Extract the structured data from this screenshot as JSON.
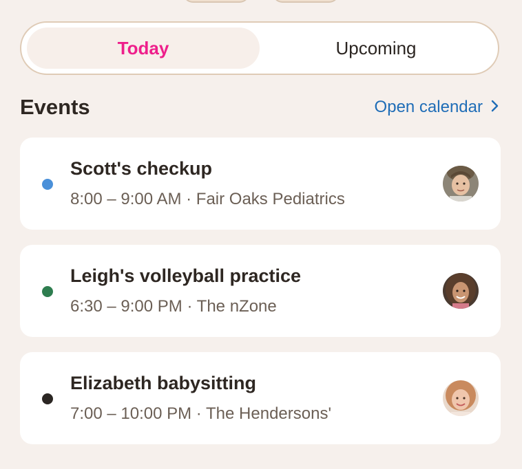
{
  "tabs": [
    {
      "label": "Today",
      "active": true
    },
    {
      "label": "Upcoming",
      "active": false
    }
  ],
  "section": {
    "title": "Events",
    "link_label": "Open calendar",
    "link_icon": "chevron-right-icon"
  },
  "events": [
    {
      "title": "Scott's checkup",
      "time": "8:00 – 9:00 AM",
      "location": "Fair Oaks Pediatrics",
      "subtitle": "8:00 – 9:00 AM · Fair Oaks Pediatrics",
      "dot_color": "#4a90d9",
      "avatar": "avatar-boy"
    },
    {
      "title": "Leigh's volleyball practice",
      "time": "6:30 – 9:00 PM",
      "location": "The nZone",
      "subtitle": "6:30 – 9:00 PM · The nZone",
      "dot_color": "#2e7d4f",
      "avatar": "avatar-girl"
    },
    {
      "title": "Elizabeth babysitting",
      "time": "7:00 – 10:00 PM",
      "location": "The Hendersons'",
      "subtitle": "7:00 – 10:00 PM · The Hendersons'",
      "dot_color": "#2b2623",
      "avatar": "avatar-teen"
    }
  ],
  "colors": {
    "background": "#f6f0ec",
    "accent": "#ee1f8b",
    "link": "#1f6db7"
  }
}
